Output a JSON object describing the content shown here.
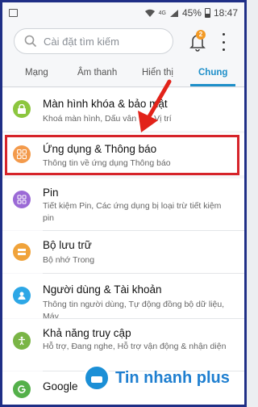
{
  "status_bar": {
    "battery": "45%",
    "time": "18:47",
    "network_label": "4G"
  },
  "search": {
    "placeholder": "Cài đặt tìm kiếm"
  },
  "notifications": {
    "badge_count": "2"
  },
  "tabs": [
    {
      "label": "Mạng",
      "active": false
    },
    {
      "label": "Âm thanh",
      "active": false
    },
    {
      "label": "Hiển thị",
      "active": false
    },
    {
      "label": "Chung",
      "active": true
    }
  ],
  "settings": [
    {
      "icon": "lock-icon",
      "color": "#8cc63f",
      "title": "Màn hình khóa & bảo mật",
      "subtitle": "Khoá màn hình, Dấu vân tay, Vị trí"
    },
    {
      "icon": "apps-icon",
      "color": "#f39a4b",
      "title": "Ứng dụng & Thông báo",
      "subtitle": "Thông tin về ứng dụng Thông báo"
    },
    {
      "icon": "grid-icon",
      "color": "#9b6ad6",
      "title": "Pin",
      "subtitle": "Tiết kiệm Pin, Các ứng dụng bị loại trừ tiết kiệm pin"
    },
    {
      "icon": "storage-icon",
      "color": "#f0a33b",
      "title": "Bộ lưu trữ",
      "subtitle": "Bộ nhớ Trong"
    },
    {
      "icon": "person-icon",
      "color": "#2da7e6",
      "title": "Người dùng & Tài khoản",
      "subtitle": "Thông tin người dùng, Tự động đồng bộ dữ liệu, Máy"
    },
    {
      "icon": "accessibility-icon",
      "color": "#7ab546",
      "title": "Khả năng truy cập",
      "subtitle": "Hỗ trợ, Đang nghe, Hỗ trợ vận động & nhận diện"
    },
    {
      "icon": "google-icon",
      "color": "#54b04a",
      "title": "Google",
      "subtitle": ""
    }
  ],
  "watermark": {
    "text": "Tin nhanh plus"
  },
  "colors": {
    "accent": "#1e8fc9",
    "highlight": "#d6232a",
    "frame": "#1f2f86"
  }
}
